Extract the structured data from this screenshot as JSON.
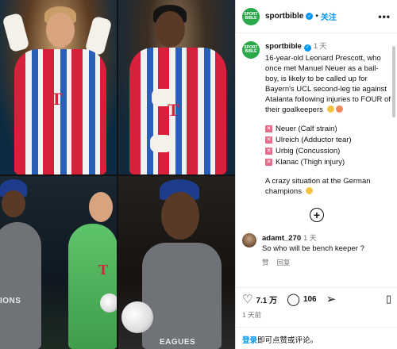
{
  "header": {
    "avatar_text": "SPORT BIBLE",
    "username": "sportbible",
    "dot": "•",
    "follow_label": "关注",
    "more_label": "•••"
  },
  "caption": {
    "username": "sportbible",
    "time": "1 天",
    "body": "16-year-old Leonard Prescott, who once met Manuel Neuer as a ball-boy, is likely to be called up for Bayern's UCL second-leg tie against Atalanta following injuries to FOUR of their goalkeepers",
    "injuries": [
      "Neuer (Calf strain)",
      "Ulreich (Adductor tear)",
      "Urbig (Concussion)",
      "Klanac (Thigh injury)"
    ],
    "closing": "A crazy situation at the German champions"
  },
  "load_more_label": "+",
  "comment": {
    "username": "adamt_270",
    "time": "1 天",
    "text": "So who will be bench keeper ?",
    "like_label": "赞",
    "reply_label": "回复"
  },
  "actions": {
    "likes": "7.1 万",
    "comments": "106",
    "icons": [
      "heart-icon",
      "comment-icon",
      "share-icon",
      "bookmark-icon"
    ]
  },
  "post_date": "1 天前",
  "login": {
    "link": "登录",
    "rest": "即可点赞或评论。"
  },
  "media": {
    "jersey_text": "T",
    "banner_left": "IONS",
    "banner_right": "EAGUES"
  },
  "colors": {
    "accent": "#0095f6",
    "brand_green": "#2aa84a",
    "injury_mark": "#e66a8a"
  }
}
